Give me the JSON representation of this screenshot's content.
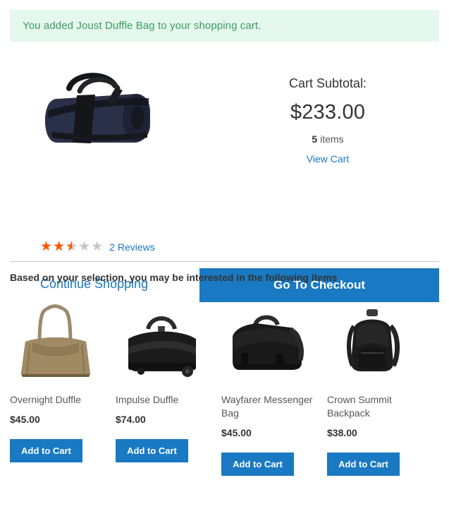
{
  "banner": {
    "message": "You added Joust Duffle Bag to your shopping cart.",
    "bg_color": "#e5f8ed",
    "text_color": "#3d9c63"
  },
  "product": {
    "name": "Joust Duffle Bag",
    "image_alt": "navy-duffle-bag",
    "rating": {
      "value": 2.5,
      "max": 5,
      "percent": "50%",
      "stars_full": "★★★★★",
      "reviews_label": "2 Reviews",
      "filled_color": "#ff5501",
      "empty_color": "#c7c7c7"
    }
  },
  "cart": {
    "subtotal_label": "Cart Subtotal:",
    "subtotal_amount": "$233.00",
    "items_count": "5",
    "items_word": "items",
    "view_cart_label": "View Cart"
  },
  "actions": {
    "continue_label": "Continue Shopping",
    "checkout_label": "Go To Checkout",
    "accent_color": "#1979c3",
    "link_color": "#1979c3"
  },
  "crosssell": {
    "title": "Based on your selection, you may be interested in the following items",
    "add_to_cart_label": "Add to Cart",
    "items": [
      {
        "name": "Overnight Duffle",
        "price": "$45.00",
        "image_alt": "tan-tote-bag",
        "add_label": "Add to Cart"
      },
      {
        "name": "Impulse Duffle",
        "price": "$74.00",
        "image_alt": "black-wheeled-duffle",
        "add_label": "Add to Cart"
      },
      {
        "name": "Wayfarer Messenger Bag",
        "price": "$45.00",
        "image_alt": "black-messenger-bag",
        "add_label": "Add to Cart"
      },
      {
        "name": "Crown Summit Backpack",
        "price": "$38.00",
        "image_alt": "black-backpack",
        "add_label": "Add to Cart"
      }
    ]
  }
}
